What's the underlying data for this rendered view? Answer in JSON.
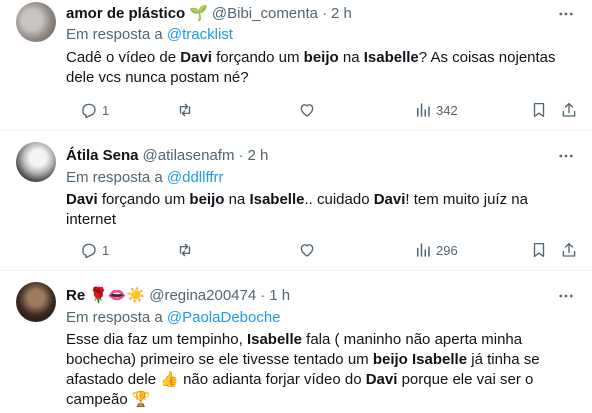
{
  "tweets": [
    {
      "name": "amor de plástico",
      "name_emoji": "🌱",
      "handle": "@Bibi_comenta",
      "time": "2 h",
      "reply_prefix": "Em resposta a",
      "reply_to": "@tracklist",
      "body": [
        {
          "t": "Cadê o vídeo de ",
          "b": false
        },
        {
          "t": "Davi",
          "b": true
        },
        {
          "t": " forçando um ",
          "b": false
        },
        {
          "t": "beijo",
          "b": true
        },
        {
          "t": " na ",
          "b": false
        },
        {
          "t": "Isabelle",
          "b": true
        },
        {
          "t": "? As coisas nojentas dele vcs nunca postam né?",
          "b": false
        }
      ],
      "replies": "1",
      "retweets": "",
      "likes": "",
      "views": "342"
    },
    {
      "name": "Átila Sena",
      "name_emoji": "",
      "handle": "@atilasenafm",
      "time": "2 h",
      "reply_prefix": "Em resposta a",
      "reply_to": "@ddllffrr",
      "body": [
        {
          "t": "Davi",
          "b": true
        },
        {
          "t": " forçando um ",
          "b": false
        },
        {
          "t": "beijo",
          "b": true
        },
        {
          "t": " na ",
          "b": false
        },
        {
          "t": "Isabelle",
          "b": true
        },
        {
          "t": ".. cuidado ",
          "b": false
        },
        {
          "t": "Davi",
          "b": true
        },
        {
          "t": "! tem muito juíz na internet",
          "b": false
        }
      ],
      "replies": "1",
      "retweets": "",
      "likes": "",
      "views": "296"
    },
    {
      "name": "Re",
      "name_emoji": "🌹👄☀️",
      "handle": "@regina200474",
      "time": "1 h",
      "reply_prefix": "Em resposta a",
      "reply_to": "@PaolaDeboche",
      "body": [
        {
          "t": "Esse dia faz um tempinho, ",
          "b": false
        },
        {
          "t": "Isabelle",
          "b": true
        },
        {
          "t": " fala ( maninho não aperta minha bochecha) primeiro se ele tivesse tentado um ",
          "b": false
        },
        {
          "t": "beijo",
          "b": true
        },
        {
          "t": " ",
          "b": false
        },
        {
          "t": "Isabelle",
          "b": true
        },
        {
          "t": " já tinha se afastado dele 👍 não adianta forjar vídeo do ",
          "b": false
        },
        {
          "t": "Davi",
          "b": true
        },
        {
          "t": " porque ele vai ser o campeão 🏆",
          "b": false
        }
      ]
    }
  ],
  "colors": {
    "text": "#0f1419",
    "secondary": "#536471",
    "link": "#1d9bf0",
    "divider": "#eff3f4"
  },
  "icons": {
    "reply": "reply-icon",
    "retweet": "retweet-icon",
    "like": "heart-icon",
    "views": "views-icon",
    "bookmark": "bookmark-icon",
    "share": "share-icon",
    "more": "more-icon"
  }
}
